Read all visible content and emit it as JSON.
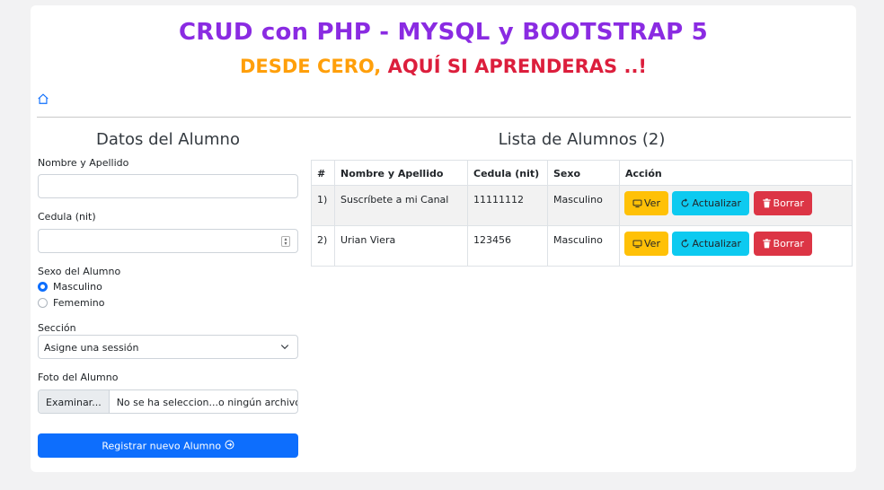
{
  "header": {
    "title": "CRUD con PHP - MYSQL y BOOTSTRAP 5",
    "subtitle_part1": "DESDE CERO,",
    "subtitle_part2": "AQUÍ SI APRENDERAS ..!",
    "home_icon": "house-icon"
  },
  "form": {
    "title": "Datos del Alumno",
    "name_label": "Nombre y Apellido",
    "name_value": "",
    "cedula_label": "Cedula (nit)",
    "cedula_value": "",
    "sex_label": "Sexo del Alumno",
    "sex_options": [
      "Masculino",
      "Fememino"
    ],
    "sex_selected": "Masculino",
    "section_label": "Sección",
    "section_selected": "Asigne una sessión",
    "photo_label": "Foto del Alumno",
    "photo_button": "Examinar...",
    "photo_filename": "No se ha seleccion...o ningún archivo.",
    "submit_label": "Registrar nuevo Alumno"
  },
  "list": {
    "title": "Lista de Alumnos (2)",
    "columns": [
      "#",
      "Nombre y Apellido",
      "Cedula (nit)",
      "Sexo",
      "Acción"
    ],
    "rows": [
      {
        "num": "1)",
        "name": "Suscríbete a mi Canal",
        "cedula": "11111112",
        "sexo": "Masculino"
      },
      {
        "num": "2)",
        "name": "Urian Viera",
        "cedula": "123456",
        "sexo": "Masculino"
      }
    ],
    "actions": {
      "view": "Ver",
      "update": "Actualizar",
      "delete": "Borrar"
    }
  },
  "colors": {
    "title": "#8a2be2",
    "subtitle_orange": "#ff9f0a",
    "subtitle_red": "#dc1e3c",
    "primary": "#0d6efd",
    "warning": "#ffc107",
    "info": "#0dcaf0",
    "danger": "#dc3545"
  }
}
